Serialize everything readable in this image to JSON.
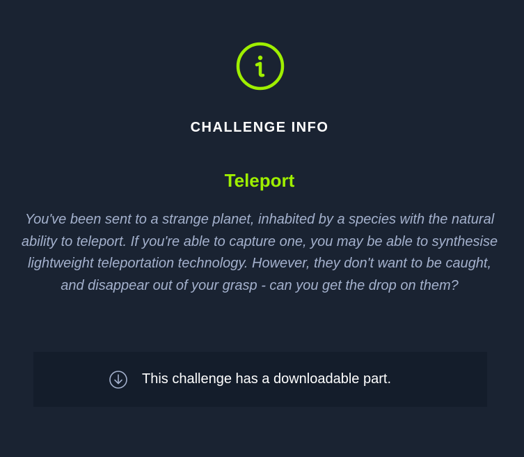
{
  "modal": {
    "heading": "CHALLENGE INFO",
    "challenge_name": "Teleport",
    "description": "You've been sent to a strange planet, inhabited by a species with the natural ability to teleport. If you're able to capture one, you may be able to synthesise lightweight teleportation technology. However, they don't want to be caught, and disappear out of your grasp - can you get the drop on them?",
    "download_notice": "This challenge has a downloadable part."
  },
  "icons": {
    "info": "info-circle-icon",
    "download": "download-circle-icon"
  },
  "colors": {
    "background": "#1a2332",
    "accent": "#9fef00",
    "description_text": "#a4b1cd",
    "download_box_bg": "#141d2b"
  }
}
